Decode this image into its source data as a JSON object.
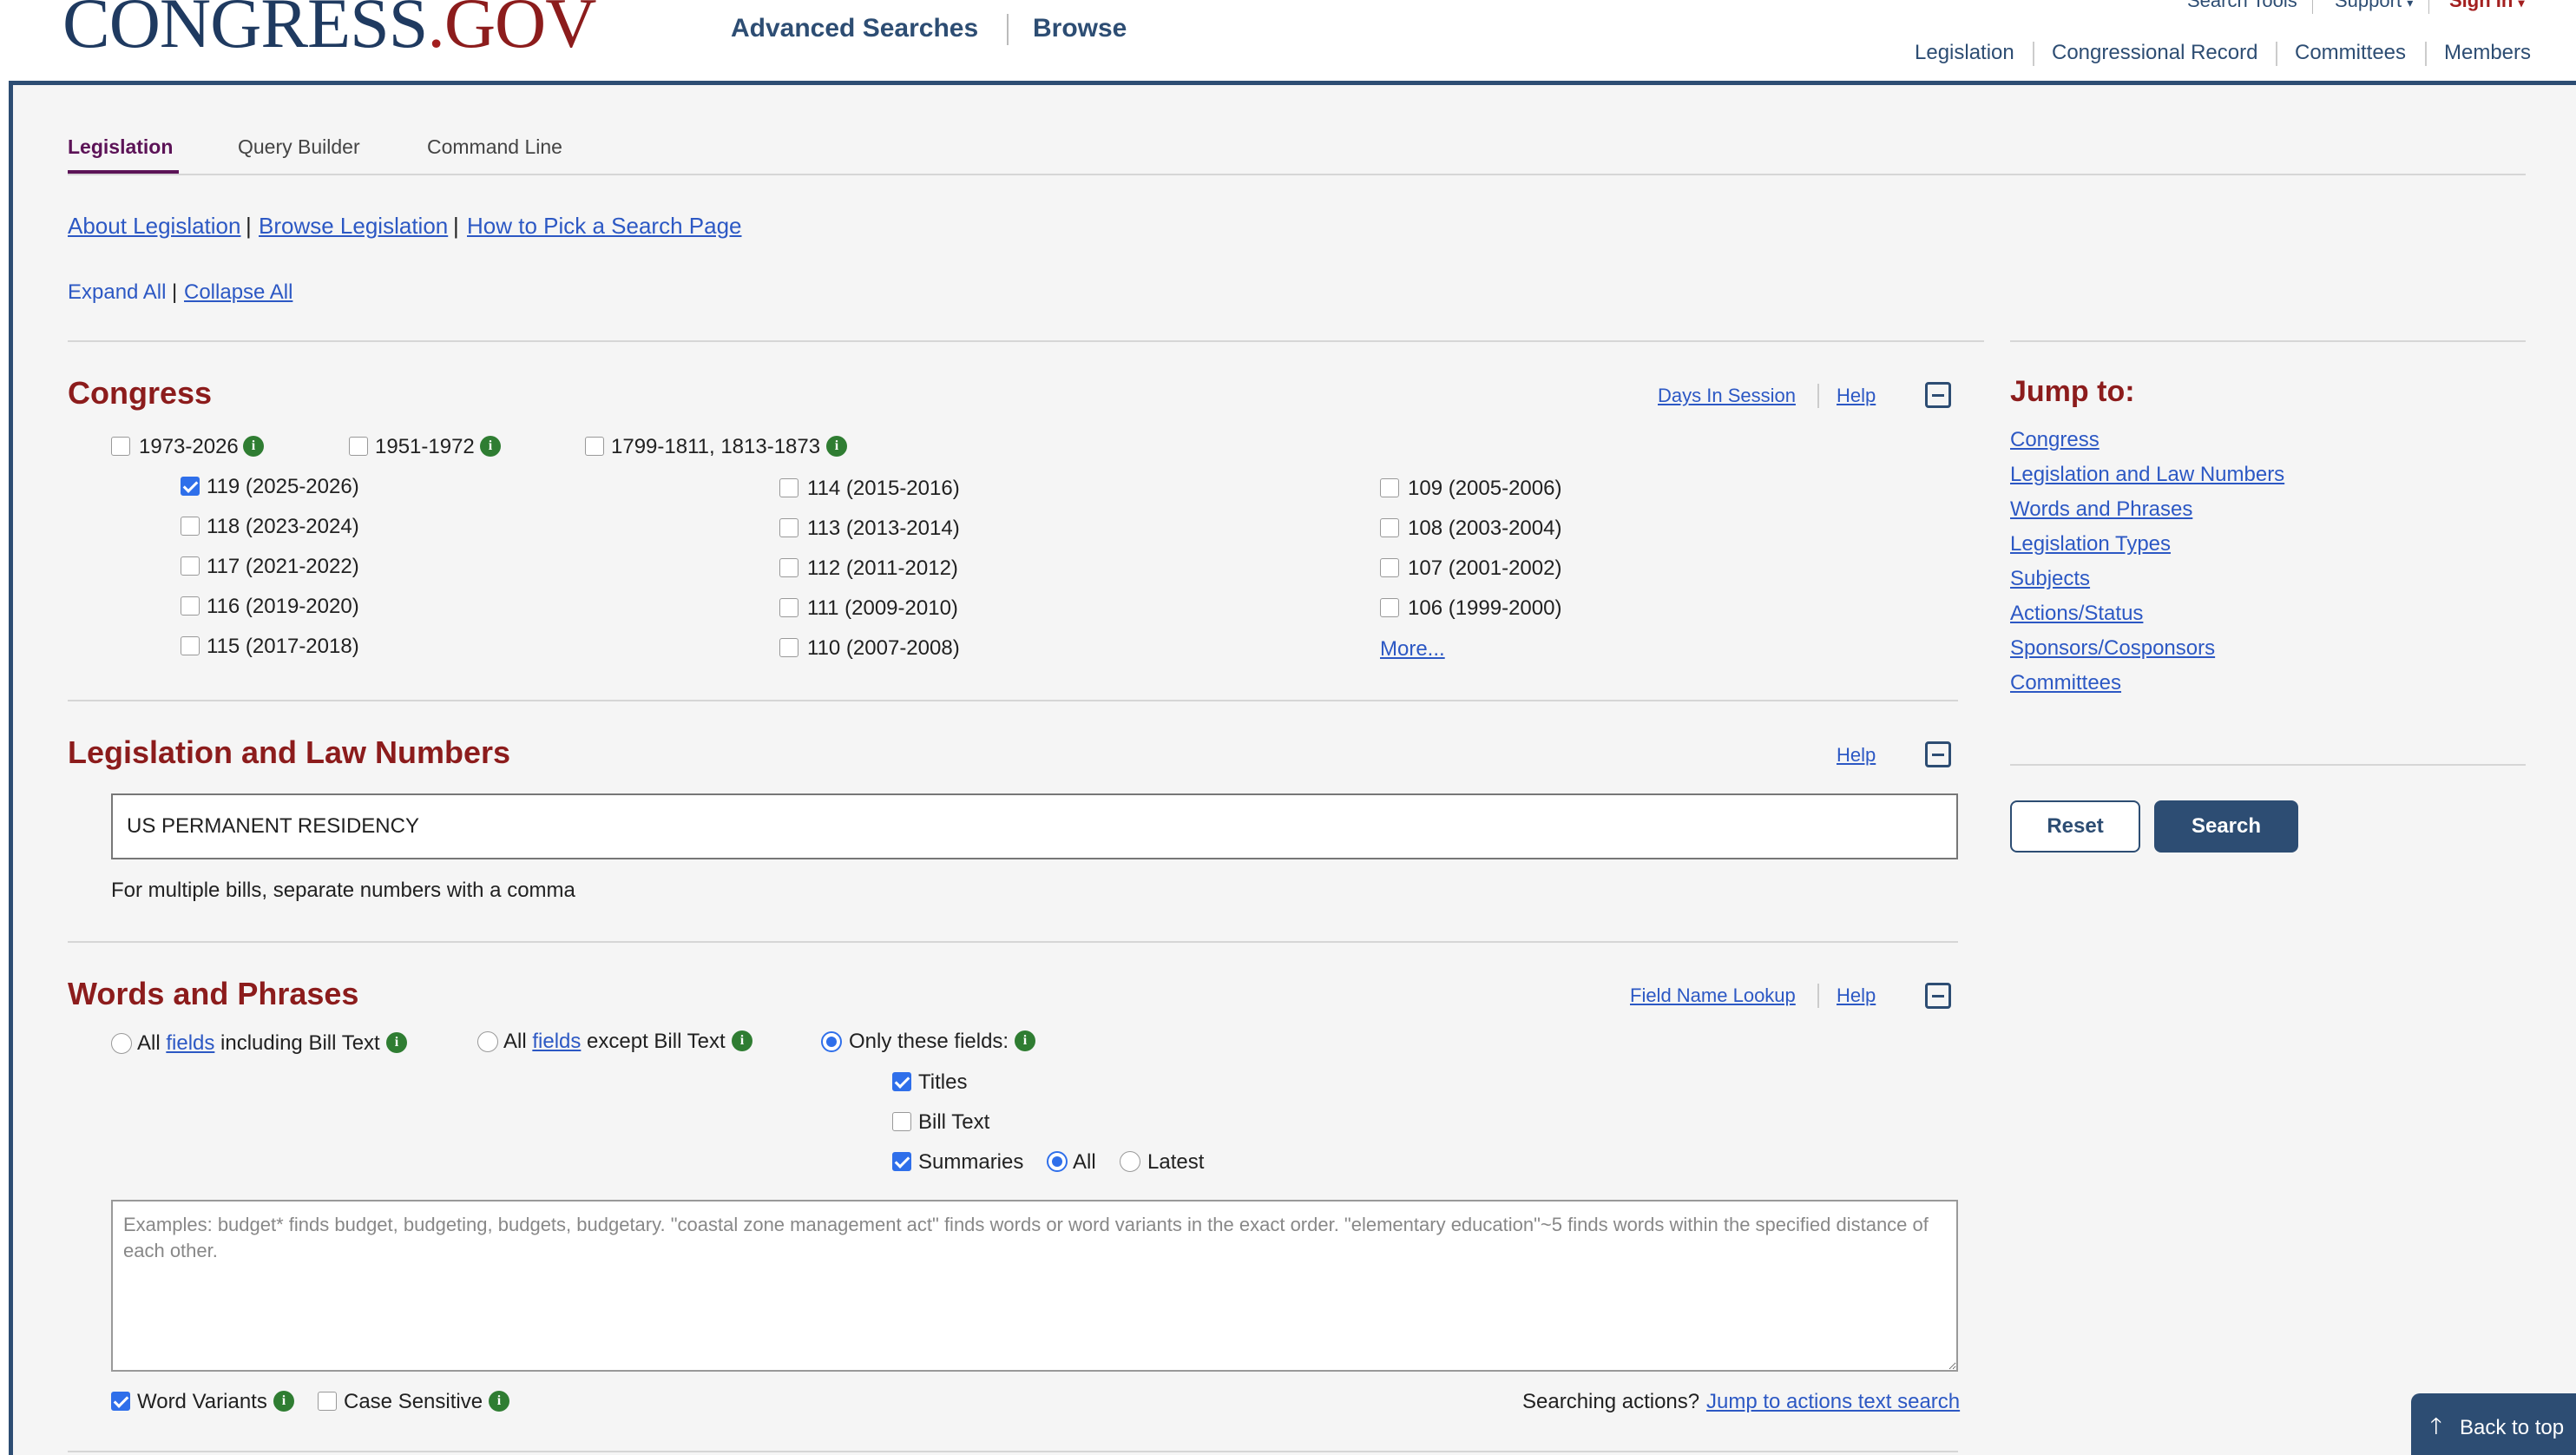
{
  "header": {
    "logo_congress": "CONGRESS",
    "logo_dot": ".",
    "logo_gov": "GOV",
    "nav": [
      "Advanced Searches",
      "Browse"
    ],
    "utility": {
      "search_tools": "Search Tools",
      "support": "Support",
      "sign_in": "Sign In"
    },
    "secondary_nav": [
      "Legislation",
      "Congressional Record",
      "Committees",
      "Members"
    ]
  },
  "tabs": [
    "Legislation",
    "Query Builder",
    "Command Line"
  ],
  "intro_links": {
    "about": "About Legislation",
    "browse": "Browse Legislation",
    "how_to": "How to Pick a Search Page",
    "sep": "|"
  },
  "expand": {
    "expand_all": "Expand All",
    "collapse_all": "Collapse All",
    "sep": "|"
  },
  "congress": {
    "title": "Congress",
    "days_in_session": "Days In Session",
    "help": "Help",
    "ranges": [
      "1973-2026",
      "1951-1972",
      "1799-1811, 1813-1873"
    ],
    "items": [
      {
        "label": "119 (2025-2026)",
        "checked": true
      },
      {
        "label": "118 (2023-2024)",
        "checked": false
      },
      {
        "label": "117 (2021-2022)",
        "checked": false
      },
      {
        "label": "116 (2019-2020)",
        "checked": false
      },
      {
        "label": "115 (2017-2018)",
        "checked": false
      },
      {
        "label": "114 (2015-2016)",
        "checked": false
      },
      {
        "label": "113 (2013-2014)",
        "checked": false
      },
      {
        "label": "112 (2011-2012)",
        "checked": false
      },
      {
        "label": "111 (2009-2010)",
        "checked": false
      },
      {
        "label": "110 (2007-2008)",
        "checked": false
      },
      {
        "label": "109 (2005-2006)",
        "checked": false
      },
      {
        "label": "108 (2003-2004)",
        "checked": false
      },
      {
        "label": "107 (2001-2002)",
        "checked": false
      },
      {
        "label": "106 (1999-2000)",
        "checked": false
      }
    ],
    "more": "More..."
  },
  "law_numbers": {
    "title": "Legislation and Law Numbers",
    "help": "Help",
    "value": "US PERMANENT RESIDENCY",
    "hint": "For multiple bills, separate numbers with a comma"
  },
  "words": {
    "title": "Words and Phrases",
    "field_lookup": "Field Name Lookup",
    "help": "Help",
    "opt_all": {
      "pre": "All",
      "link": "fields",
      "post": "including Bill Text"
    },
    "opt_except": {
      "pre": "All",
      "link": "fields",
      "post": "except Bill Text"
    },
    "opt_only": "Only these fields:",
    "fields": {
      "titles": "Titles",
      "bill_text": "Bill Text",
      "summaries": "Summaries",
      "all": "All",
      "latest": "Latest"
    },
    "placeholder": "Examples: budget* finds budget, budgeting, budgets, budgetary. \"coastal zone management act\" finds words or word variants in the exact order. \"elementary education\"~5 finds words within the specified distance of each other.",
    "word_variants": "Word Variants",
    "case_sensitive": "Case Sensitive",
    "searching_actions": "Searching actions?",
    "jump_actions": "Jump to actions text search"
  },
  "jump_to": {
    "title": "Jump to:",
    "links": [
      "Congress",
      "Legislation and Law Numbers",
      "Words and Phrases",
      "Legislation Types",
      "Subjects",
      "Actions/Status",
      "Sponsors/Cosponsors",
      "Committees"
    ]
  },
  "buttons": {
    "reset": "Reset",
    "search": "Search"
  },
  "back_to_top": "Back to top",
  "colors": {
    "navy": "#2d4d73",
    "section_red": "#8c1c1c",
    "tab_purple": "#5c1357",
    "link_blue": "#2c58c4",
    "info_green": "#2f7d32",
    "check_blue": "#2f6fea"
  }
}
